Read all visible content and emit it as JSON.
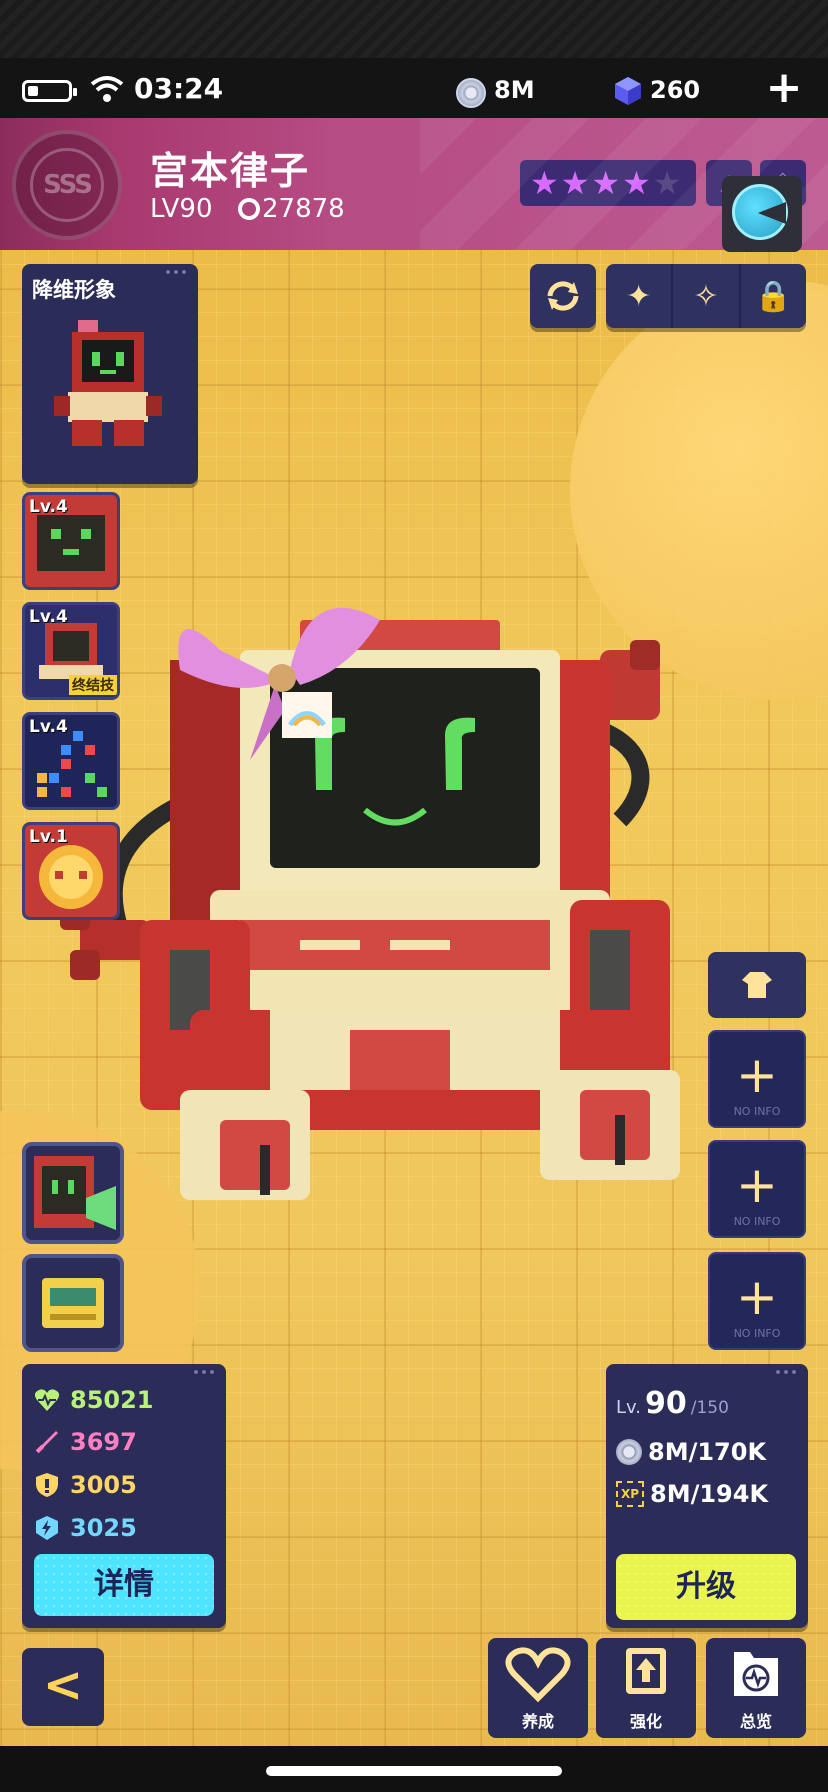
{
  "status_bar": {
    "time": "03:24",
    "coins": "8M",
    "gems": "260",
    "add_label": "+"
  },
  "character": {
    "rank": "SSS",
    "name": "宫本律子",
    "level": "LV90",
    "power": "27878",
    "stars_filled": 4,
    "stars_total": 5
  },
  "skin_panel": {
    "title": "降维形象"
  },
  "skills": [
    {
      "level": "Lv.4"
    },
    {
      "level": "Lv.4",
      "tag": "终结技"
    },
    {
      "level": "Lv.4"
    },
    {
      "level": "Lv.1"
    }
  ],
  "stats": {
    "hp": "85021",
    "attack": "3697",
    "defense": "3005",
    "speed": "3025",
    "detail_label": "详情"
  },
  "level_panel": {
    "lv_prefix": "Lv.",
    "level": "90",
    "max_level": "/150",
    "coin_cost": "8M/170K",
    "xp_icon_label": "XP",
    "xp_cost": "8M/194K",
    "upgrade_label": "升级"
  },
  "slots": [
    {
      "label": "NO INFO"
    },
    {
      "label": "NO INFO"
    },
    {
      "label": "NO INFO"
    }
  ],
  "bottom_nav": {
    "back_label": "<",
    "items": [
      {
        "label": "养成"
      },
      {
        "label": "强化"
      },
      {
        "label": "总览"
      }
    ]
  },
  "colors": {
    "header": "#b54c83",
    "panel": "#2b2d58",
    "accent_cyan": "#4ee4ff",
    "accent_yellow": "#e9f54c",
    "background": "#f0c75c"
  }
}
